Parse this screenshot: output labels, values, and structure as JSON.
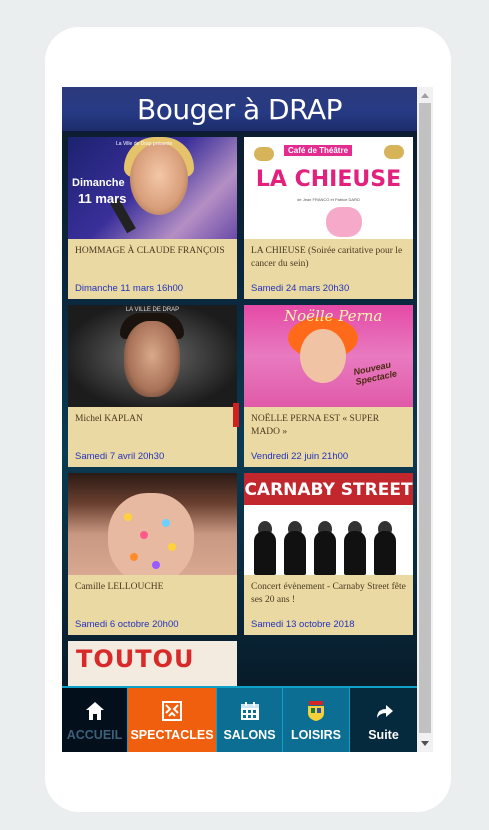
{
  "header": {
    "title": "Bouger à DRAP"
  },
  "events": [
    {
      "name": "HOMMAGE À CLAUDE FRANÇOIS",
      "date": "Dimanche 11 mars 16h00",
      "poster": {
        "top_text": "La Ville de Drap présente",
        "line1": "Dimanche",
        "line2": "11 mars"
      }
    },
    {
      "name": "LA CHIEUSE (Soirée caritative pour le cancer du sein)",
      "date": "Samedi 24 mars 20h30",
      "poster": {
        "header": "Café de Théâtre",
        "title": "LA CHIEUSE",
        "sub": "de Jean FRANCO et Patrice DARD"
      }
    },
    {
      "name": "Michel KAPLAN",
      "date": "Samedi 7 avril 20h30",
      "poster": {
        "tag": "LA VILLE DE DRAP"
      }
    },
    {
      "name": "NOËLLE PERNA EST « SUPER MADO »",
      "date": "Vendredi 22 juin 21h00",
      "poster": {
        "title": "Noëlle Perna",
        "badge": "Nouveau Spectacle"
      }
    },
    {
      "name": "Camille LELLOUCHE",
      "date": "Samedi 6 octobre 20h00"
    },
    {
      "name": "Concert évènement - Carnaby Street fête ses 20 ans !",
      "date": "Samedi 13 octobre 2018",
      "poster": {
        "band": "CARNABY STREET"
      }
    },
    {
      "name": "",
      "date": "",
      "poster": {
        "title": "TOUTOU"
      }
    }
  ],
  "nav": {
    "accueil": {
      "label": "ACCUEIL",
      "icon": "home-icon"
    },
    "spectacles": {
      "label": "SPECTACLES",
      "icon": "theater-icon"
    },
    "salons": {
      "label": "SALONS",
      "icon": "calendar-icon"
    },
    "loisirs": {
      "label": "LOISIRS",
      "icon": "crest-icon"
    },
    "suite": {
      "label": "Suite",
      "icon": "arrow-forward-icon"
    }
  },
  "colors": {
    "title_bar": "#263a84",
    "card_bg": "#ead9a3",
    "date_text": "#2233bb",
    "nav_active": "#ef5f0d",
    "nav_accent": "#0fa2c9"
  }
}
